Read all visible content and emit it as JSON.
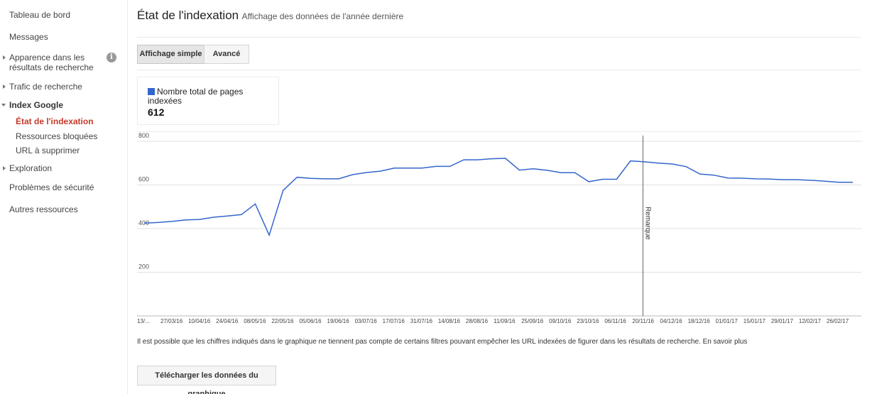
{
  "sidebar": {
    "items": [
      {
        "label": "Tableau de bord"
      },
      {
        "label": "Messages"
      },
      {
        "label": "Apparence dans les résultats de recherche"
      },
      {
        "label": "Trafic de recherche"
      },
      {
        "label": "Index Google"
      },
      {
        "label": "Exploration"
      },
      {
        "label": "Problèmes de sécurité"
      },
      {
        "label": "Autres ressources"
      }
    ],
    "subitems": [
      {
        "label": "État de l'indexation"
      },
      {
        "label": "Ressources bloquées"
      },
      {
        "label": "URL à supprimer"
      }
    ],
    "info_icon_glyph": "i"
  },
  "header": {
    "title": "État de l'indexation",
    "subtitle": "Affichage des données de l'année dernière"
  },
  "view_toggle": {
    "simple_label": "Affichage simple",
    "advanced_label": "Avancé",
    "selected": "simple"
  },
  "legend": {
    "label": "Nombre total de pages indexées",
    "value": "612",
    "color": "#3366cc"
  },
  "chart_data": {
    "type": "line",
    "ylim": [
      0,
      800
    ],
    "yticks": [
      200,
      400,
      600,
      800
    ],
    "x_ticks": [
      "13/...",
      "27/03/16",
      "10/04/16",
      "24/04/16",
      "08/05/16",
      "22/05/16",
      "05/06/16",
      "19/06/16",
      "03/07/16",
      "17/07/16",
      "31/07/16",
      "14/08/16",
      "28/08/16",
      "11/09/16",
      "25/09/16",
      "09/10/16",
      "23/10/16",
      "06/11/16",
      "20/11/16",
      "04/12/16",
      "18/12/16",
      "01/01/17",
      "15/01/17",
      "29/01/17",
      "12/02/17",
      "26/02/17"
    ],
    "series": [
      {
        "name": "Nombre total de pages indexées",
        "color": "#3366cc",
        "values": [
          425,
          428,
          433,
          440,
          442,
          452,
          458,
          464,
          513,
          370,
          575,
          635,
          630,
          628,
          628,
          647,
          657,
          663,
          677,
          677,
          677,
          685,
          685,
          715,
          715,
          720,
          722,
          668,
          674,
          667,
          656,
          656,
          615,
          626,
          626,
          710,
          706,
          700,
          696,
          684,
          650,
          645,
          632,
          631,
          628,
          627,
          624,
          624,
          621,
          617,
          612,
          612
        ]
      }
    ],
    "annotation": {
      "label": "Remarque",
      "index": 36
    }
  },
  "footer": {
    "note": "Il est possible que les chiffres indiqués dans le graphique ne tiennent pas compte de certains filtres pouvant empêcher les URL indexées de figurer dans les résultats de recherche.",
    "learn_more": "En savoir plus",
    "download_label": "Télécharger les données du graphique"
  }
}
